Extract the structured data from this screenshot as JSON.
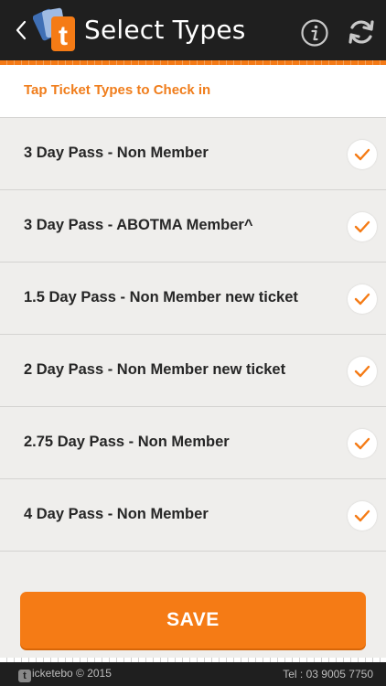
{
  "header": {
    "title": "Select Types",
    "back_icon": "chevron-left-icon",
    "logo_letter": "t",
    "info_icon": "info-icon",
    "refresh_icon": "refresh-icon"
  },
  "instruction": "Tap Ticket Types to Check in",
  "ticket_types": [
    {
      "label": "3 Day Pass - Non Member",
      "checked": true
    },
    {
      "label": "3 Day Pass - ABOTMA Member^",
      "checked": true
    },
    {
      "label": "1.5 Day Pass - Non Member new ticket",
      "checked": true
    },
    {
      "label": "2 Day Pass - Non Member new ticket",
      "checked": true
    },
    {
      "label": "2.75 Day Pass - Non Member",
      "checked": true
    },
    {
      "label": "4 Day Pass - Non Member",
      "checked": true
    }
  ],
  "save_label": "SAVE",
  "footer": {
    "logo_letter": "t",
    "brand": "icketebo © 2015",
    "phone": "Tel : 03 9005 7750"
  },
  "colors": {
    "accent": "#f57b15",
    "header_bg": "#1f1f1f",
    "list_bg": "#efeeec",
    "text": "#262626"
  }
}
